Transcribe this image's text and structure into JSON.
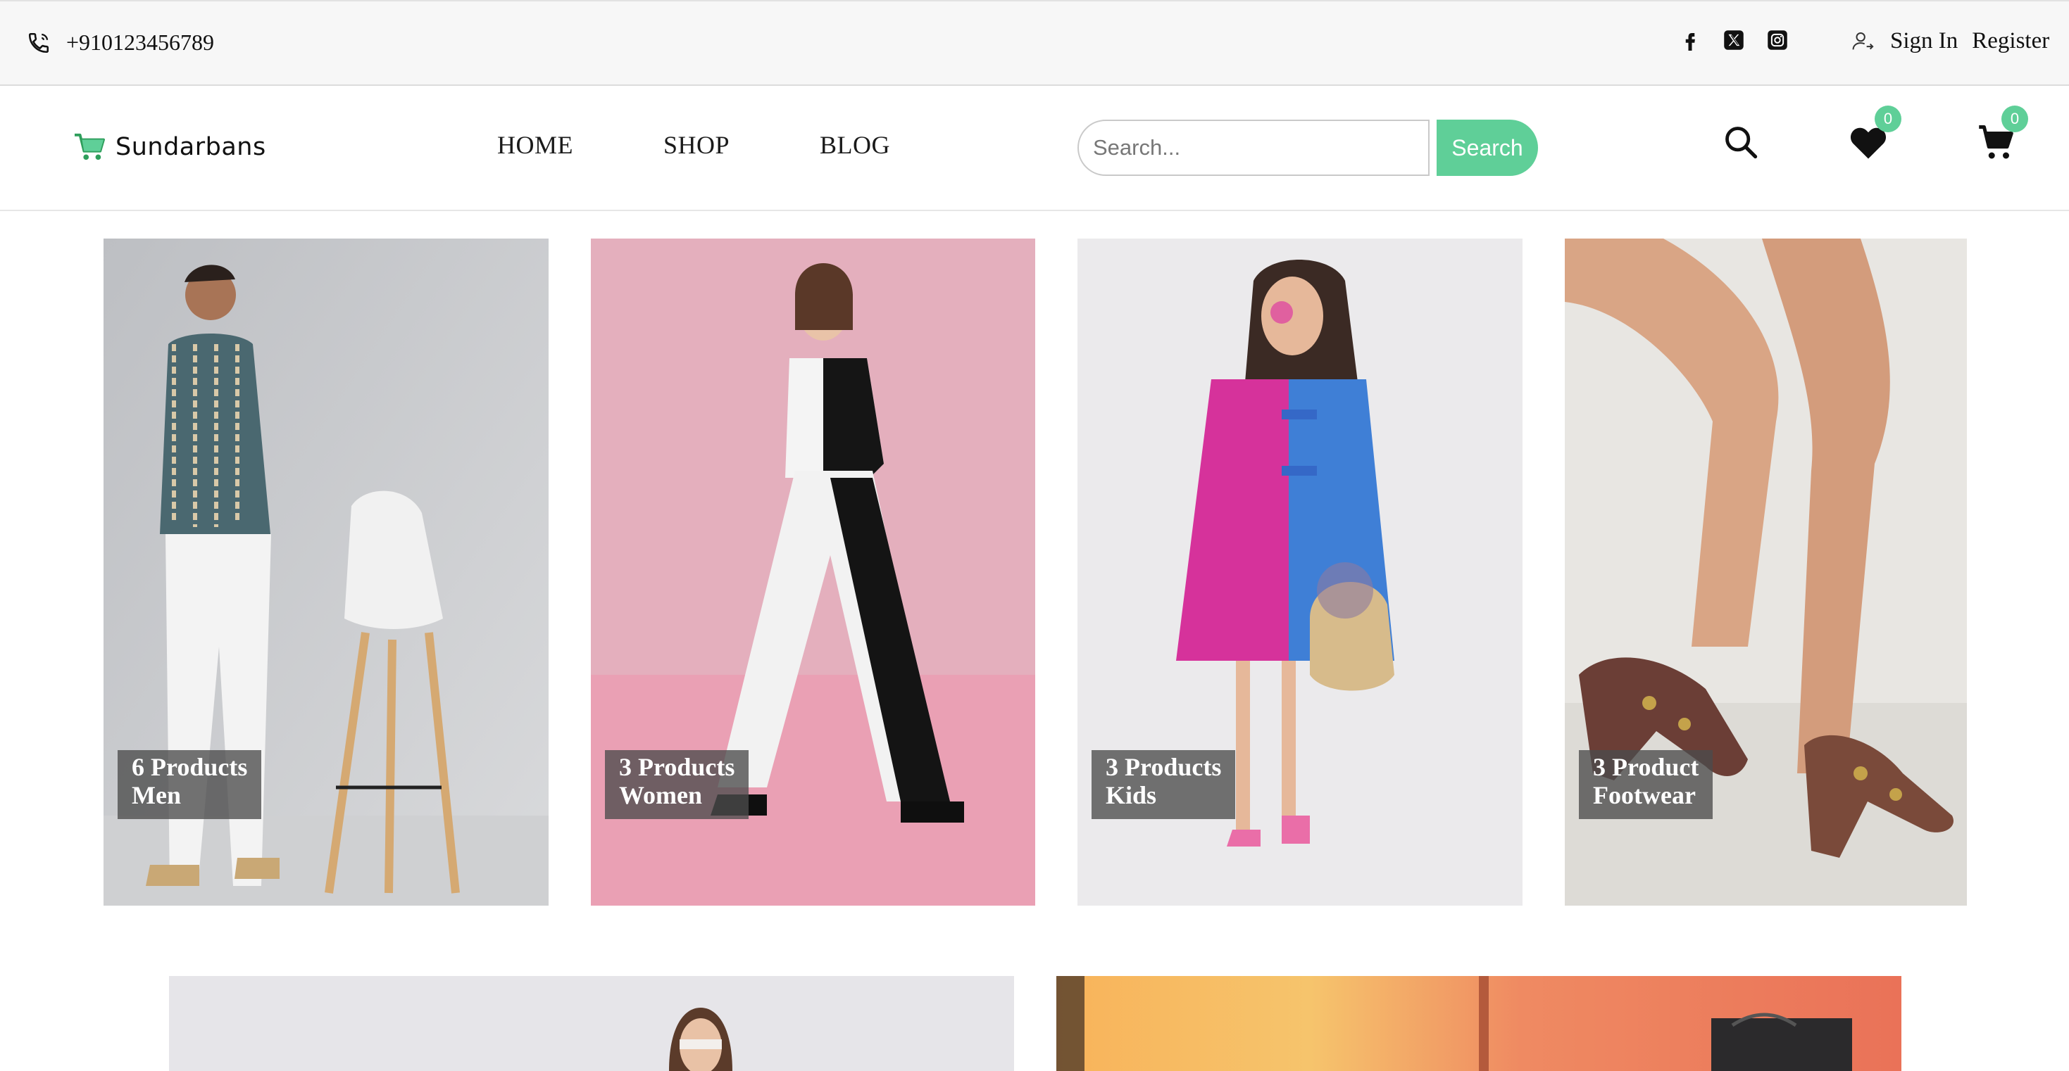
{
  "topbar": {
    "phone": "+910123456789",
    "social": [
      "facebook-icon",
      "x-twitter-icon",
      "instagram-icon"
    ],
    "sign_in": "Sign In",
    "register": "Register"
  },
  "header": {
    "logo": "Sundarbans",
    "nav": [
      "HOME",
      "SHOP",
      "BLOG"
    ],
    "search": {
      "placeholder": "Search...",
      "button": "Search"
    },
    "wishlist_count": "0",
    "cart_count": "0"
  },
  "categories": [
    {
      "count": "6 Products",
      "name": "Men"
    },
    {
      "count": "3 Products",
      "name": "Women"
    },
    {
      "count": "3 Products",
      "name": "Kids"
    },
    {
      "count": "3 Product",
      "name": "Footwear"
    }
  ],
  "colors": {
    "accent": "#5fcf98",
    "topbar_bg": "#f7f7f7",
    "label_bg": "#4b4b4b"
  }
}
